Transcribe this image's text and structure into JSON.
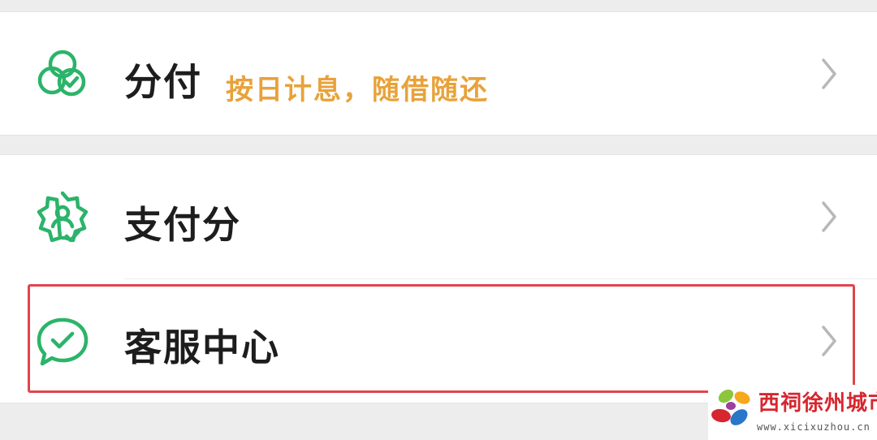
{
  "colors": {
    "accent_green": "#2bb46a",
    "subtitle_orange": "#e8a23a",
    "highlight_red": "#e0444d",
    "chevron_gray": "#b8b8b8"
  },
  "items": [
    {
      "label": "分付",
      "subtitle": "按日计息，随借随还",
      "icon": "fenfu-circles-icon"
    },
    {
      "label": "支付分",
      "icon": "badge-person-icon"
    },
    {
      "label": "客服中心",
      "icon": "chat-bubble-check-icon"
    }
  ],
  "watermark": {
    "title": "西祠徐州城市站",
    "url": "www.xicixuzhou.cn"
  }
}
